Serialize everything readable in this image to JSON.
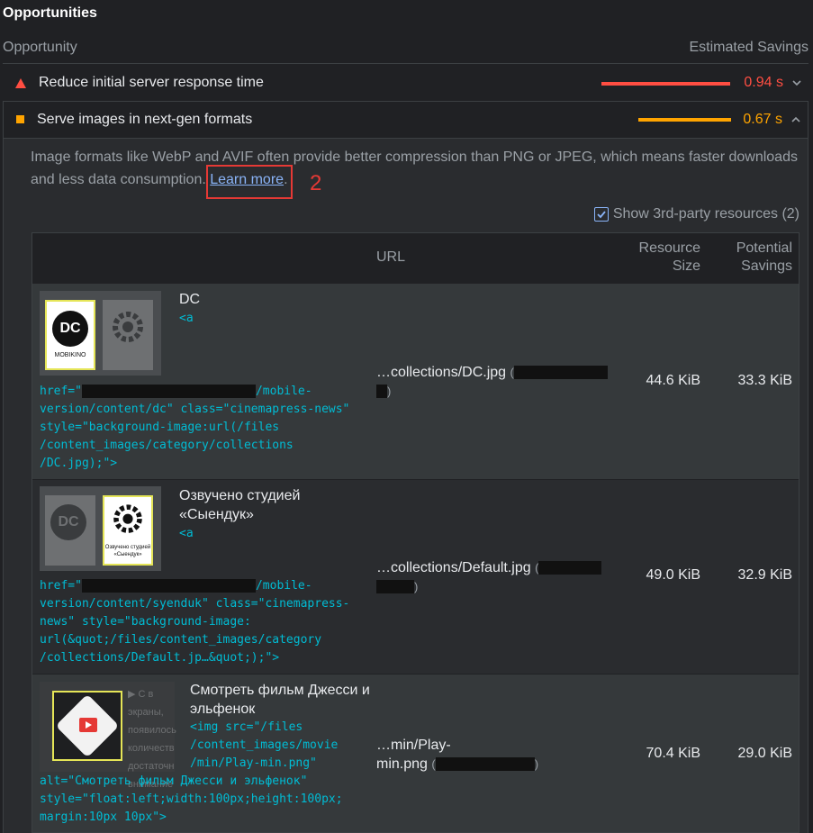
{
  "section": {
    "title": "Opportunities"
  },
  "columns": {
    "opportunity": "Opportunity",
    "savings": "Estimated Savings"
  },
  "audits": [
    {
      "title": "Reduce initial server response time",
      "value": "0.94 s",
      "color": "#ff4e42",
      "level": 1.0,
      "icon": "fail-triangle-icon"
    },
    {
      "title": "Serve images in next-gen formats",
      "value": "0.67 s",
      "color": "#ffa400",
      "level": 0.71,
      "icon": "average-square-icon"
    }
  ],
  "description": {
    "text": "Image formats like WebP and AVIF often provide better compression than PNG or JPEG, which means faster downloads and less data consumption. ",
    "link": "Learn more",
    "tail": ".",
    "annotation": "2"
  },
  "third_party": {
    "label": "Show 3rd-party resources (2)",
    "checked": true
  },
  "table": {
    "headers": {
      "url": "URL",
      "size_l1": "Resource",
      "size_l2": "Size",
      "savings_l1": "Potential",
      "savings_l2": "Savings"
    },
    "rows": [
      {
        "name": "DC",
        "code_open": "<a",
        "code_l1_pre": "href=\"",
        "code_l1_post": "/mobile-",
        "code_rest": "version/content/dc\" class=\"cinemapress-news\"\nstyle=\"background-image:url(/files\n/content_images/category/collections\n/DC.jpg);\">",
        "url": "…collections/DC.jpg",
        "size": "44.6 KiB",
        "savings": "33.3 KiB",
        "logo_text": "DC",
        "logo_caption": "MOBIKINO"
      },
      {
        "name": "Озвучено студией «Сыендук»",
        "code_open": "<a",
        "code_l1_pre": "href=\"",
        "code_l1_post": "/mobile-",
        "code_rest": "version/content/syenduk\" class=\"cinemapress-\nnews\" style=\"background-image:\nurl(&quot;/files/content_images/category\n/collections/Default.jp…&quot;);\">",
        "url": "…collections/Default.jpg",
        "size": "49.0 KiB",
        "savings": "32.9 KiB",
        "logo_text": "DC",
        "logo_caption": "Озвучено студией «Сыендук»"
      },
      {
        "name": "Смотреть фильм Джесси и эльфенок",
        "code_open": "<img src=\"/files\n/content_images/movie\n/min/Play-min.png\"",
        "code_rest": "alt=\"Смотреть фильм Джесси и эльфенок\"\nstyle=\"float:left;width:100px;height:100px;\nmargin:10px 10px\">",
        "url_l1": "…min/Play-",
        "url_l2": "min.png",
        "size": "70.4 KiB",
        "savings": "29.0 KiB",
        "side_text": "▶ С в\nэкраны,\nпоявилось\nколичеств\nдостаточн\nвнимание"
      }
    ]
  }
}
